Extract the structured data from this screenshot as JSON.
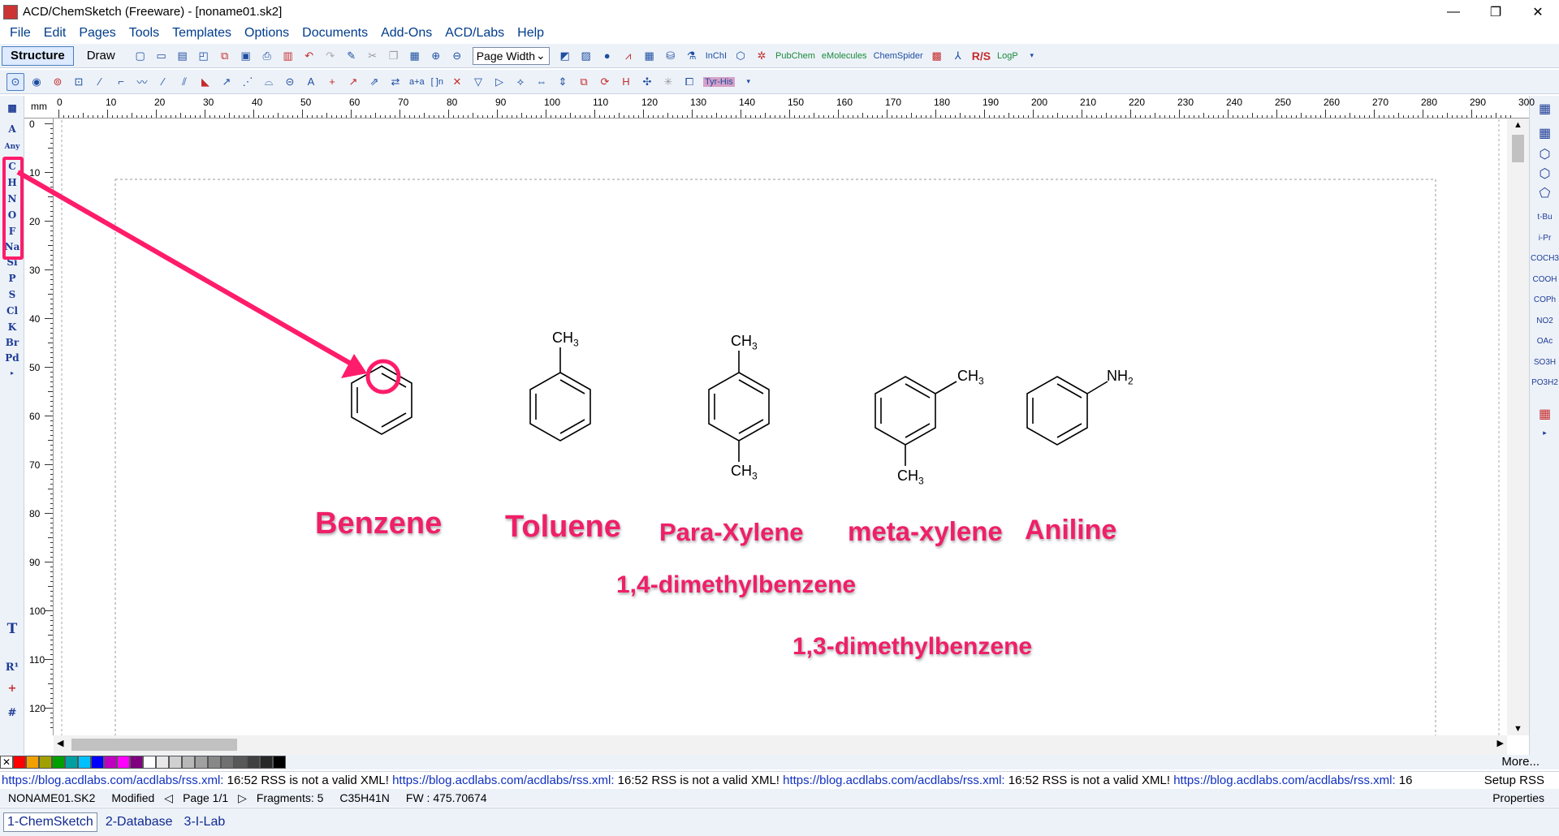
{
  "window": {
    "title": "ACD/ChemSketch (Freeware) - [noname01.sk2]",
    "controls": {
      "minimize": "—",
      "restore": "❐",
      "close": "✕"
    }
  },
  "menu": [
    "File",
    "Edit",
    "Pages",
    "Tools",
    "Templates",
    "Options",
    "Documents",
    "Add-Ons",
    "ACD/Labs",
    "Help"
  ],
  "toolbar": {
    "mode_structure": "Structure",
    "mode_draw": "Draw",
    "zoom_value": "Page Width",
    "pubchem": "PubChem",
    "emolecules": "eMolecules",
    "chemspider": "ChemSpider",
    "rs": "R/S",
    "logp": "LogP",
    "inchi": "InChI",
    "arrow_label": "a+a",
    "bracket_label": "[ ]n",
    "tyr_label": "Tyr-His"
  },
  "left_toolbar": {
    "units": "mm",
    "elements": [
      "A",
      "Any",
      "C",
      "H",
      "N",
      "O",
      "F",
      "Na",
      "Si",
      "P",
      "S",
      "Cl",
      "K",
      "Br",
      "Pd"
    ],
    "bottom_tools": [
      "T",
      "R¹",
      "+",
      "#"
    ]
  },
  "right_toolbar": {
    "groups": [
      "t-Bu",
      "i-Pr",
      "COCH3",
      "COOH",
      "COPh",
      "NO2",
      "OAc",
      "SO3H",
      "PO3H2"
    ]
  },
  "rulers": {
    "top_ticks": [
      "0",
      "10",
      "20",
      "30",
      "40",
      "50",
      "60",
      "70",
      "80",
      "90",
      "100",
      "110",
      "120",
      "130",
      "140",
      "150",
      "160",
      "170",
      "180",
      "190",
      "200",
      "210",
      "220",
      "230",
      "240",
      "250",
      "260",
      "270",
      "280",
      "290",
      "300"
    ],
    "left_ticks": [
      "0",
      "10",
      "20",
      "30",
      "40",
      "50",
      "60",
      "70",
      "80",
      "90",
      "100",
      "110",
      "120"
    ]
  },
  "structures": {
    "toluene_sub": "CH3",
    "para_top": "CH3",
    "para_bottom": "CH3",
    "meta_right": "CH3",
    "meta_bottom": "CH3",
    "aniline_sub": "NH2"
  },
  "annotations": {
    "benzene": "Benzene",
    "toluene": "Toluene",
    "para_xylene": "Para-Xylene",
    "meta_xylene": "meta-xylene",
    "aniline": "Aniline",
    "para_iupac": "1,4-dimethylbenzene",
    "meta_iupac": "1,3-dimethylbenzene"
  },
  "colors": {
    "annotation": "#ef1f68",
    "palette": [
      "#ff0000",
      "#f0a000",
      "#a0a000",
      "#00a000",
      "#00a0a0",
      "#00c0ff",
      "#0000ff",
      "#c000c0",
      "#ff00ff",
      "#800080",
      "#ffffff",
      "#e8e8e8",
      "#d0d0d0",
      "#b8b8b8",
      "#a0a0a0",
      "#888888",
      "#707070",
      "#585858",
      "#404040",
      "#282828",
      "#000000"
    ]
  },
  "palette_more": "More...",
  "rss": {
    "segments": [
      {
        "link": "https://blog.acdlabs.com/acdlabs/rss.xml:",
        "msg": " 16:52 RSS is not a valid XML! "
      },
      {
        "link": "https://blog.acdlabs.com/acdlabs/rss.xml:",
        "msg": " 16:52 RSS is not a valid XML! "
      },
      {
        "link": "https://blog.acdlabs.com/acdlabs/rss.xml:",
        "msg": " 16:52 RSS is not a valid XML! "
      },
      {
        "link": "https://blog.acdlabs.com/acdlabs/rss.xml:",
        "msg": " 16"
      }
    ],
    "setup": "Setup RSS"
  },
  "status": {
    "file": "NONAME01.SK2",
    "state": "Modified",
    "page": "Page 1/1",
    "fragments": "Fragments: 5",
    "formula": "C35H41N",
    "fw": "FW : 475.70674",
    "properties": "Properties"
  },
  "app_tabs": [
    "1-ChemSketch",
    "2-Database",
    "3-I-Lab"
  ]
}
